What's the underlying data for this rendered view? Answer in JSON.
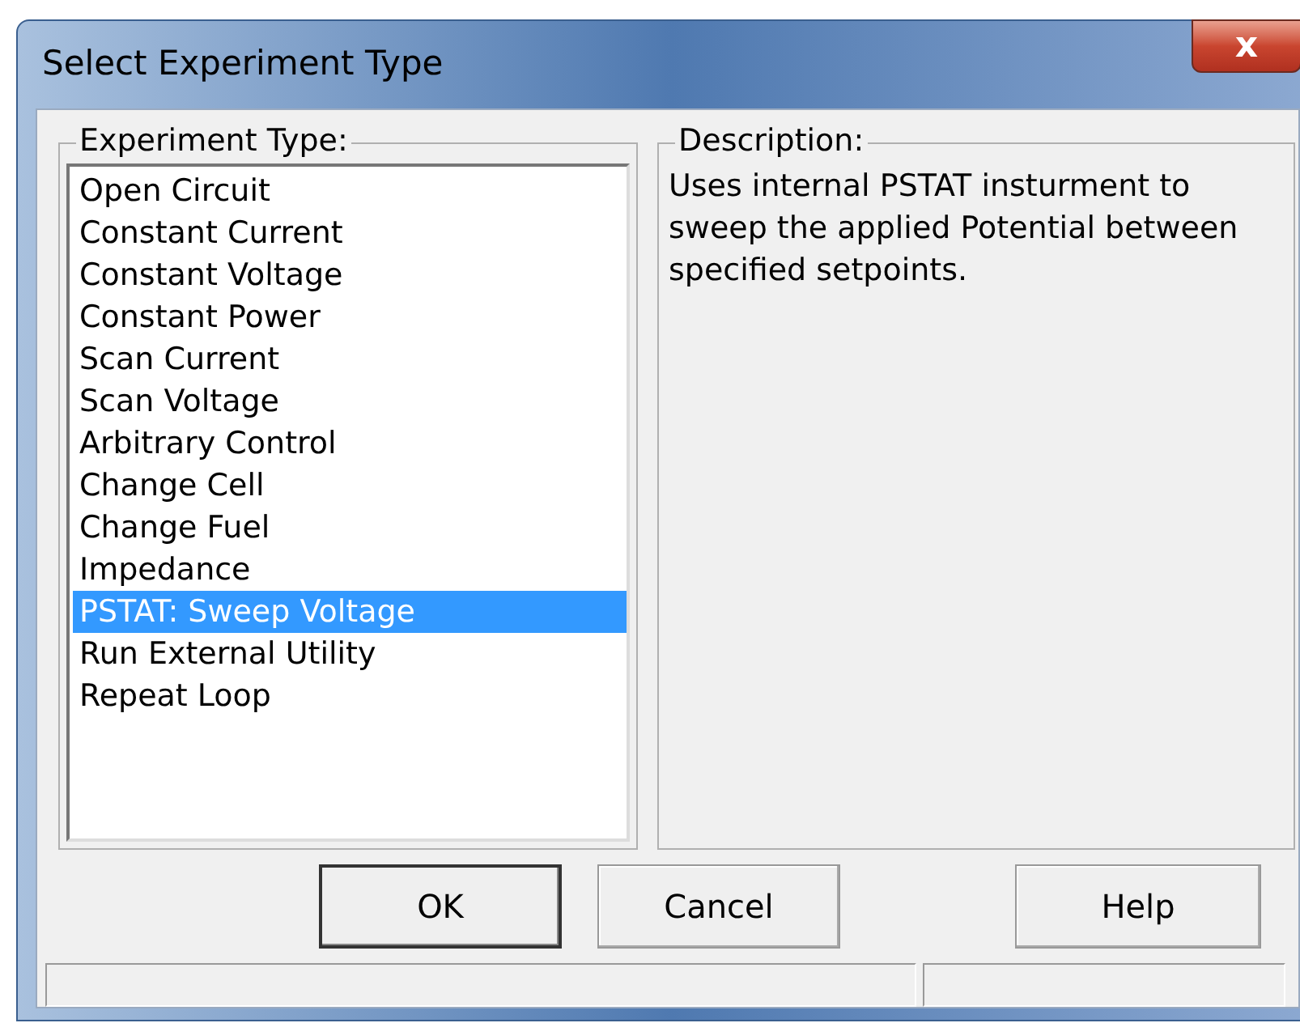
{
  "window": {
    "title": "Select Experiment Type",
    "close": "x"
  },
  "experiment_type": {
    "label": "Experiment Type:",
    "items": [
      {
        "label": "Open Circuit",
        "selected": false
      },
      {
        "label": "Constant Current",
        "selected": false
      },
      {
        "label": "Constant Voltage",
        "selected": false
      },
      {
        "label": "Constant Power",
        "selected": false
      },
      {
        "label": "Scan Current",
        "selected": false
      },
      {
        "label": "Scan Voltage",
        "selected": false
      },
      {
        "label": "Arbitrary Control",
        "selected": false
      },
      {
        "label": "Change Cell",
        "selected": false
      },
      {
        "label": "Change Fuel",
        "selected": false
      },
      {
        "label": "Impedance",
        "selected": false
      },
      {
        "label": "PSTAT: Sweep Voltage",
        "selected": true
      },
      {
        "label": "Run External Utility",
        "selected": false
      },
      {
        "label": "Repeat Loop",
        "selected": false
      }
    ]
  },
  "description": {
    "label": "Description:",
    "text": "Uses internal PSTAT insturment to sweep the applied Potential between specified setpoints."
  },
  "buttons": [
    {
      "label": "OK",
      "default": true
    },
    {
      "label": "Cancel",
      "default": false
    },
    {
      "label": "Help",
      "default": false
    }
  ]
}
